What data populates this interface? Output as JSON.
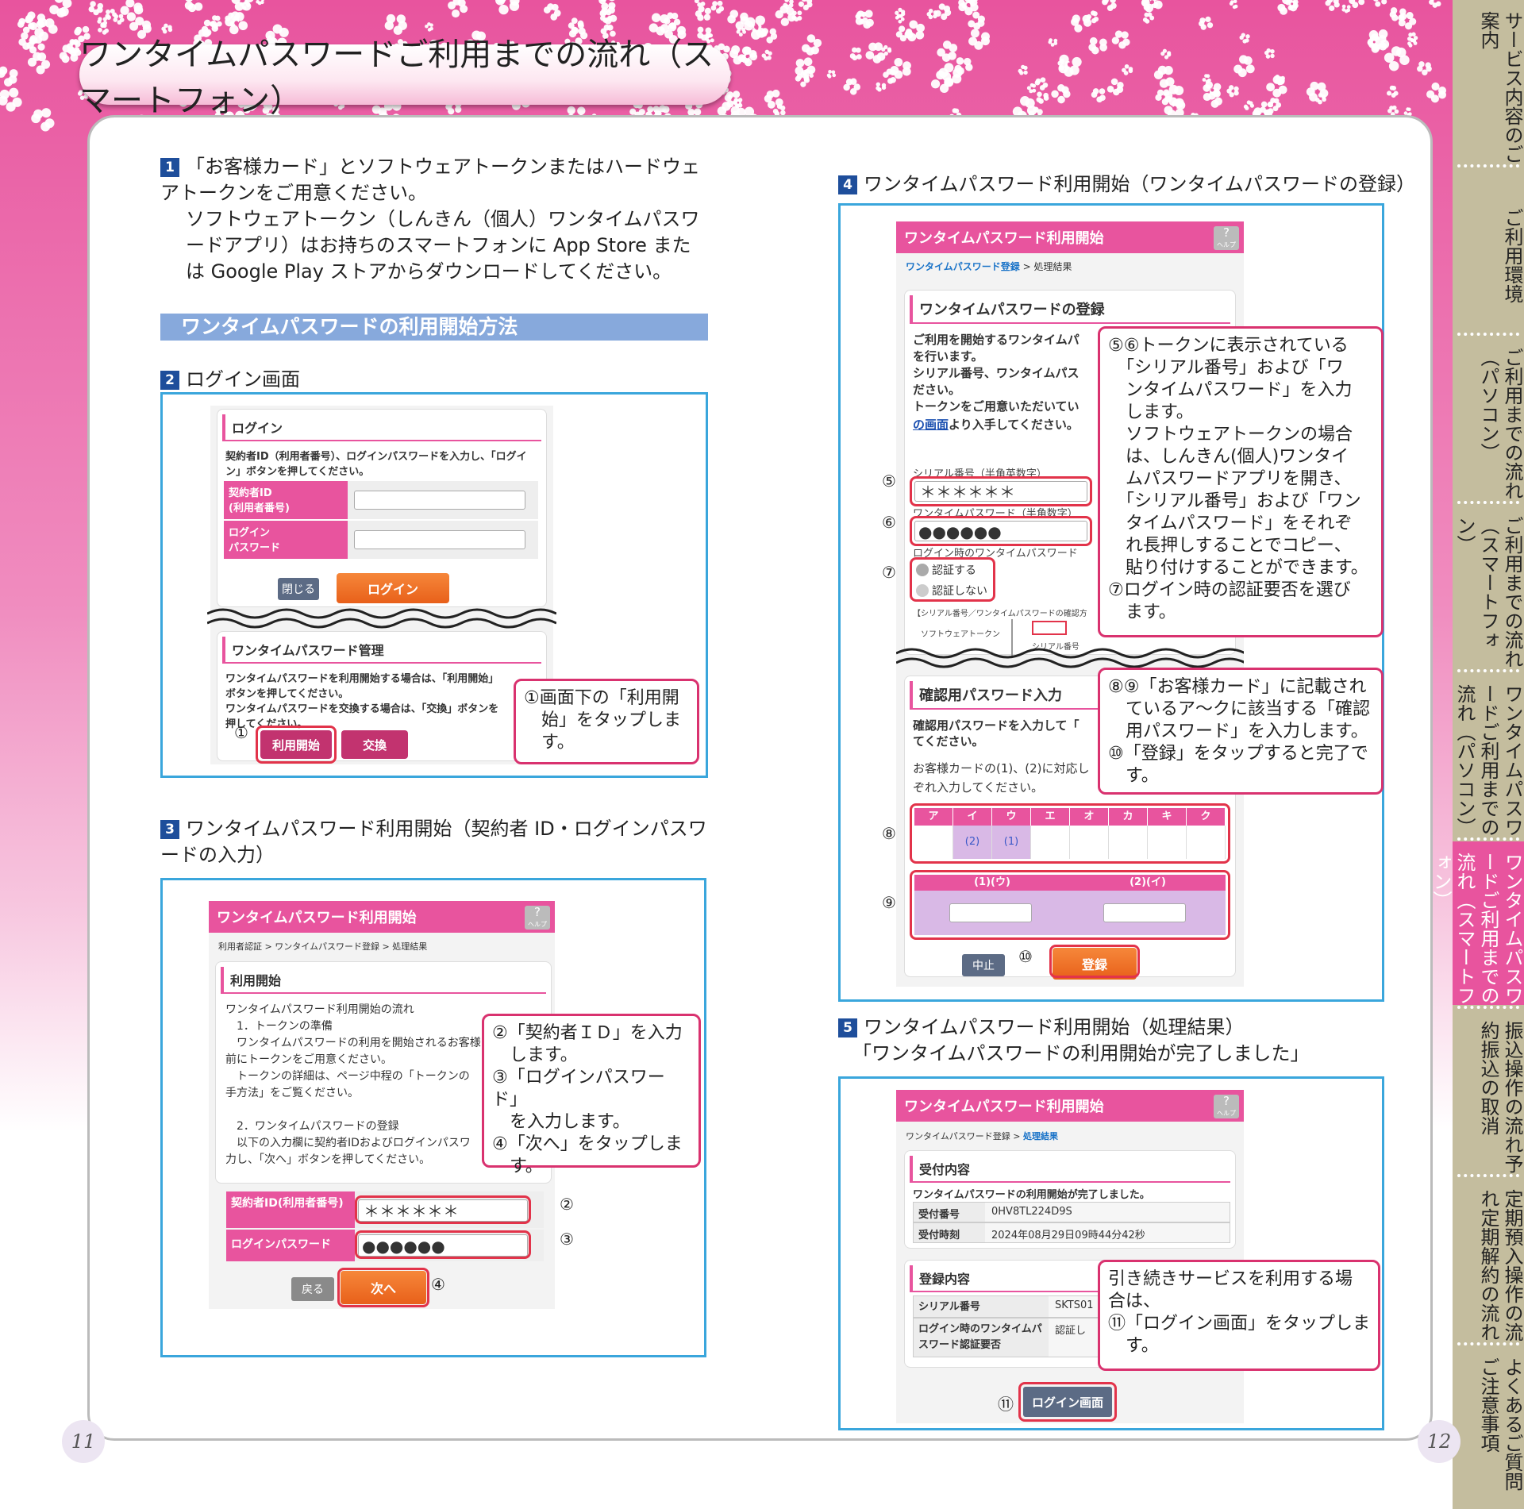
{
  "title": "ワンタイムパスワードご利用までの流れ（スマートフォン）",
  "page_left": "11",
  "page_right": "12",
  "sidebar": [
    {
      "label": "サービス内容のご案内",
      "active": false
    },
    {
      "label": "ご利用環境",
      "active": false
    },
    {
      "label": "ご利用までの流れ（パソコン）",
      "active": false
    },
    {
      "label": "ご利用までの流れ（スマートフォン）",
      "active": false
    },
    {
      "label": "ワンタイムパスワードご利用までの流れ（パソコン）",
      "active": false
    },
    {
      "label": "ワンタイムパスワードご利用までの流れ（スマートフォン）",
      "active": true
    },
    {
      "label": "振込操作の流れ予約振込の取消",
      "active": false
    },
    {
      "label": "定期預入操作の流れ定期解約の流れ",
      "active": false
    },
    {
      "label": "よくあるご質問ご注意事項",
      "active": false
    }
  ],
  "step1": {
    "num": "1",
    "text": "「お客様カード」とソフトウェアトークンまたはハードウェアトークンをご用意ください。",
    "text2": "ソフトウェアトークン（しんきん（個人）ワンタイムパスワードアプリ）はお持ちのスマートフォンに App Store または Google Play ストアからダウンロードしてください。"
  },
  "section_header": "ワンタイムパスワードの利用開始方法",
  "step2": {
    "num": "2",
    "label": "ログイン画面",
    "login_title": "ログイン",
    "login_desc": "契約者ID（利用者番号）、ログインパスワードを入力し、「ログイン」ボタンを押してください。",
    "id_label": "契約者ID\n(利用者番号)",
    "pw_label": "ログイン\nパスワード",
    "close": "閉じる",
    "login": "ログイン",
    "otp_title": "ワンタイムパスワード管理",
    "otp_desc": "ワンタイムパスワードを利用開始する場合は、「利用開始」ボタンを押してください。\nワンタイムパスワードを交換する場合は、「交換」ボタンを押してください。",
    "start": "利用開始",
    "exchange": "交換",
    "mark": "①",
    "callout": "①画面下の「利用開\n　始」をタップしま\n　す。"
  },
  "step3": {
    "num": "3",
    "label": "ワンタイムパスワード利用開始（契約者 ID・ログインパスワードの入力）",
    "header": "ワンタイムパスワード利用開始",
    "help": "?",
    "help_sub": "ヘルプ",
    "crumb": "利用者認証 > ワンタイムパスワード登録 > 処理結果",
    "card_title": "利用開始",
    "body": "ワンタイムパスワード利用開始の流れ\n　1．トークンの準備\n　ワンタイムパスワードの利用を開始されるお客様は、\n前にトークンをご用意ください。\n　トークンの詳細は、ページ中程の「トークンの\n手方法」をご覧ください。\n\n　2．ワンタイムパスワードの登録\n　以下の入力欄に契約者IDおよびログインパスワ\n力し、「次へ」ボタンを押してください。",
    "id_label": "契約者ID(利用者番号)",
    "pw_label": "ログインパスワード",
    "id_val": "＊＊＊＊＊＊",
    "pw_val": "●●●●●●",
    "back": "戻る",
    "next": "次へ",
    "m2": "②",
    "m3": "③",
    "m4": "④",
    "callout": "②「契約者ＩＤ」を入力\n　します。\n③「ログインパスワード」\n　を入力します。\n④「次へ」をタップしま\n　す。"
  },
  "step4": {
    "num": "4",
    "label": "ワンタイムパスワード利用開始（ワンタイムパスワードの登録）",
    "header": "ワンタイムパスワード利用開始",
    "help": "?",
    "help_sub": "ヘルプ",
    "crumb_link": "ワンタイムパスワード登録",
    "crumb_rest": " > 処理結果",
    "card_title": "ワンタイムパスワードの登録",
    "body": "ご利用を開始するワンタイムパ\nを行います。\nシリアル番号、ワンタイムパス\nださい。\nトークンをご用意いただいてい",
    "body_link": "の画面",
    "body_tail": "より入手してください。",
    "serial_label": "シリアル番号（半角英数字）",
    "serial_val": "＊＊＊＊＊＊",
    "otp_label": "ワンタイムパスワード（半角数字）",
    "otp_val": "●●●●●●",
    "auth_label": "ログイン時のワンタイムパスワード",
    "radio1": "認証する",
    "radio2": "認証しない",
    "note": "【シリアル番号／ワンタイムパスワードの確認方",
    "soft": "ソフトウェアトークン",
    "serial_small": "シリアル番号",
    "m5": "⑤",
    "m6": "⑥",
    "m7": "⑦",
    "m8": "⑧",
    "m9": "⑨",
    "m10": "⑩",
    "callout1": "⑤⑥トークンに表示されている\n　「シリアル番号」および「ワ\n　ンタイムパスワード」を入力\n　します。\n　ソフトウェアトークンの場合\n　は、しんきん(個人)ワンタイ\n　ムパスワードアプリを開き、\n　「シリアル番号」および「ワン\n　タイムパスワード」をそれぞ\n　れ長押しすることでコピー、\n　貼り付けすることができます。\n⑦ログイン時の認証要否を選び\n　ます。",
    "confirm_title": "確認用パスワード入力",
    "confirm_body": "確認用パスワードを入力して「\nてください。",
    "confirm_body2": "お客様カードの(1)、(2)に対応し\nぞれ入力してください。",
    "grid_head": [
      "ア",
      "イ",
      "ウ",
      "エ",
      "オ",
      "カ",
      "キ",
      "ク"
    ],
    "grid_vals": [
      "",
      "(2)",
      "(1)",
      "",
      "",
      "",
      "",
      ""
    ],
    "col1": "(1)(ウ)",
    "col2": "(2)(イ)",
    "cancel": "中止",
    "register": "登録",
    "callout2": "⑧⑨「お客様カード」に記載され\n　ているア～クに該当する「確認\n　用パスワード」を入力します。\n⑩「登録」をタップすると完了で\n　す。"
  },
  "step5": {
    "num": "5",
    "label": "ワンタイムパスワード利用開始（処理結果）",
    "label2": "「ワンタイムパスワードの利用開始が完了しました」",
    "header": "ワンタイムパスワード利用開始",
    "help": "?",
    "help_sub": "ヘルプ",
    "crumb": "ワンタイムパスワード登録 > ",
    "crumb_link": "処理結果",
    "card1_title": "受付内容",
    "done": "ワンタイムパスワードの利用開始が完了しました。",
    "rows": [
      {
        "k": "受付番号",
        "v": "0HV8TL224D9S"
      },
      {
        "k": "受付時刻",
        "v": "2024年08月29日09時44分42秒"
      }
    ],
    "card2_title": "登録内容",
    "rows2": [
      {
        "k": "シリアル番号",
        "v": "SKTS01"
      },
      {
        "k": "ログイン時のワンタイムパスワード認証要否",
        "v": "認証し"
      }
    ],
    "login_btn": "ログイン画面",
    "m11": "⑪",
    "callout": "引き続きサービスを利用する場\n合は、\n⑪「ログイン画面」をタップしま\n　す。"
  }
}
